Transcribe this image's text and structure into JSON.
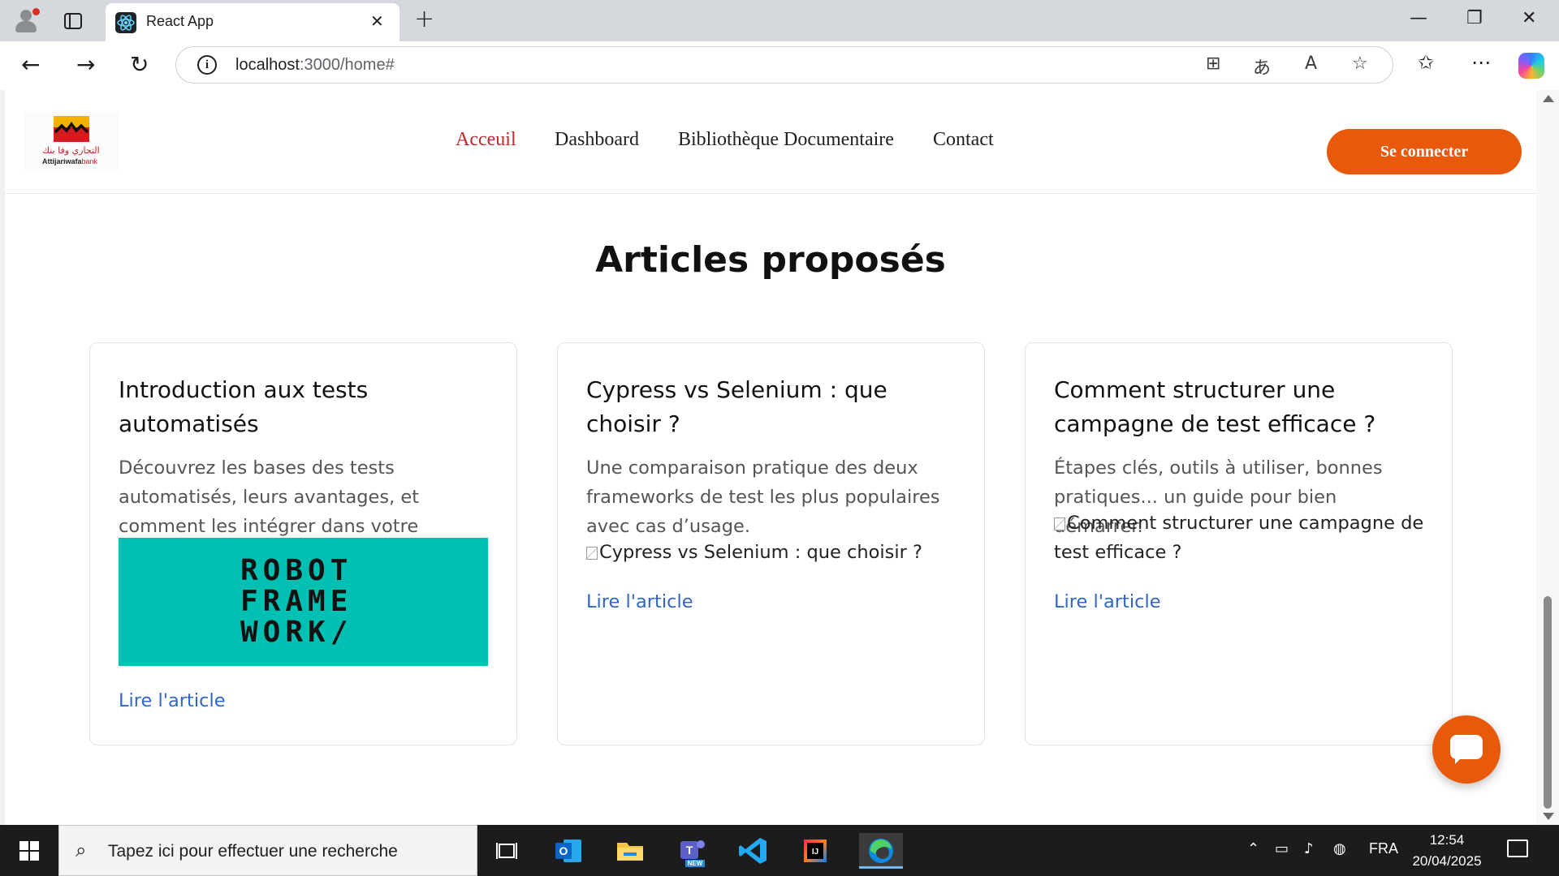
{
  "browser": {
    "tab_title": "React App",
    "url_host": "localhost",
    "url_path": ":3000/home#"
  },
  "site": {
    "logo_arabic": "التجاري وفا بنك",
    "logo_brand": "Attijariwafa",
    "logo_brand_suffix": "bank",
    "nav": [
      "Acceuil",
      "Dashboard",
      "Bibliothèque Documentaire",
      "Contact"
    ],
    "login_button": "Se connecter",
    "section_title": "Articles proposés"
  },
  "articles": [
    {
      "title": "Introduction aux tests automatisés",
      "description": "Découvrez les bases des tests automatisés, leurs avantages, et comment les intégrer dans votre pipeline CI/CD.",
      "image_text": "ROBOT FRAME WORK/",
      "link": "Lire l'article"
    },
    {
      "title": "Cypress vs Selenium : que choisir ?",
      "description": "Une comparaison pratique des deux frameworks de test les plus populaires avec cas d’usage.",
      "image_alt": "Cypress vs Selenium : que choisir ?",
      "link": "Lire l'article"
    },
    {
      "title": "Comment structurer une campagne de test efficace ?",
      "description": "Étapes clés, outils à utiliser, bonnes pratiques... un guide pour bien démarrer.",
      "image_alt": "Comment structurer une campagne de test efficace ?",
      "link": "Lire l'article"
    }
  ],
  "taskbar": {
    "search_placeholder": "Tapez ici pour effectuer une recherche",
    "language": "FRA",
    "time": "12:54",
    "date": "20/04/2025",
    "teams_badge": "NEW"
  },
  "colors": {
    "accent_orange": "#e8590c",
    "nav_active": "#c1272d",
    "link_blue": "#2f66c8",
    "robot_bg": "#00bfb3"
  }
}
